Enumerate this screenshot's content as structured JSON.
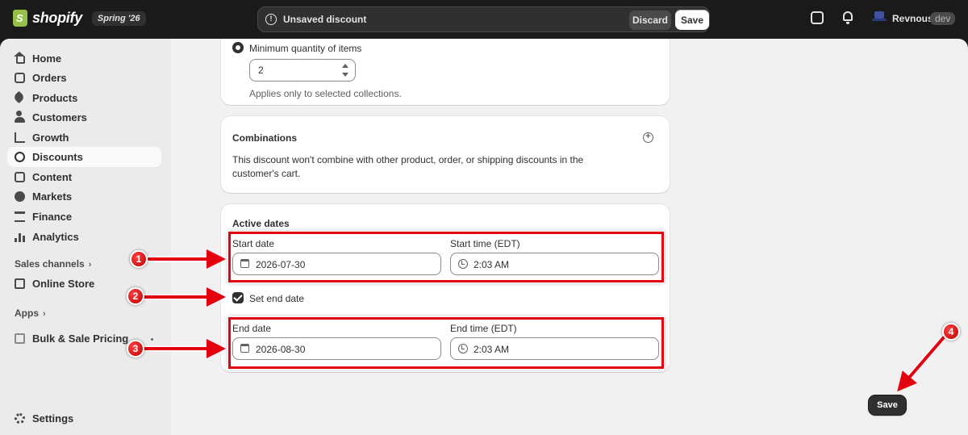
{
  "topbar": {
    "brand": "shopify",
    "edition": "Spring '26",
    "unsaved_text": "Unsaved discount",
    "discard_label": "Discard",
    "save_label": "Save",
    "store_name": "Revnous",
    "store_badge": "dev"
  },
  "sidebar": {
    "items": [
      {
        "label": "Home",
        "icon": "home-icon"
      },
      {
        "label": "Orders",
        "icon": "inbox-icon"
      },
      {
        "label": "Products",
        "icon": "tag-icon"
      },
      {
        "label": "Customers",
        "icon": "person-icon"
      },
      {
        "label": "Growth",
        "icon": "chart-icon"
      },
      {
        "label": "Discounts",
        "icon": "discount-icon"
      },
      {
        "label": "Content",
        "icon": "content-icon"
      },
      {
        "label": "Markets",
        "icon": "globe-icon"
      },
      {
        "label": "Finance",
        "icon": "bank-icon"
      },
      {
        "label": "Analytics",
        "icon": "bar-chart-icon"
      }
    ],
    "sales_channels_label": "Sales channels",
    "online_store_label": "Online Store",
    "apps_label": "Apps",
    "app_item_label": "Bulk & Sale Pricing",
    "settings_label": "Settings"
  },
  "min_qty": {
    "radio_label": "Minimum quantity of items",
    "value": "2",
    "help": "Applies only to selected collections."
  },
  "combinations": {
    "title": "Combinations",
    "text": "This discount won't combine with other product, order, or shipping discounts in the customer's cart."
  },
  "active_dates": {
    "title": "Active dates",
    "start_date_label": "Start date",
    "start_date": "2026-07-30",
    "start_time_label": "Start time (EDT)",
    "start_time": "2:03 AM",
    "set_end_label": "Set end date",
    "end_date_label": "End date",
    "end_date": "2026-08-30",
    "end_time_label": "End time (EDT)",
    "end_time": "2:03 AM"
  },
  "annotations": [
    "1",
    "2",
    "3",
    "4"
  ],
  "footer": {
    "save_label": "Save"
  },
  "colors": {
    "annotation": "#e4000f",
    "topbar": "#1a1a1a",
    "primary_button": "#303030"
  }
}
